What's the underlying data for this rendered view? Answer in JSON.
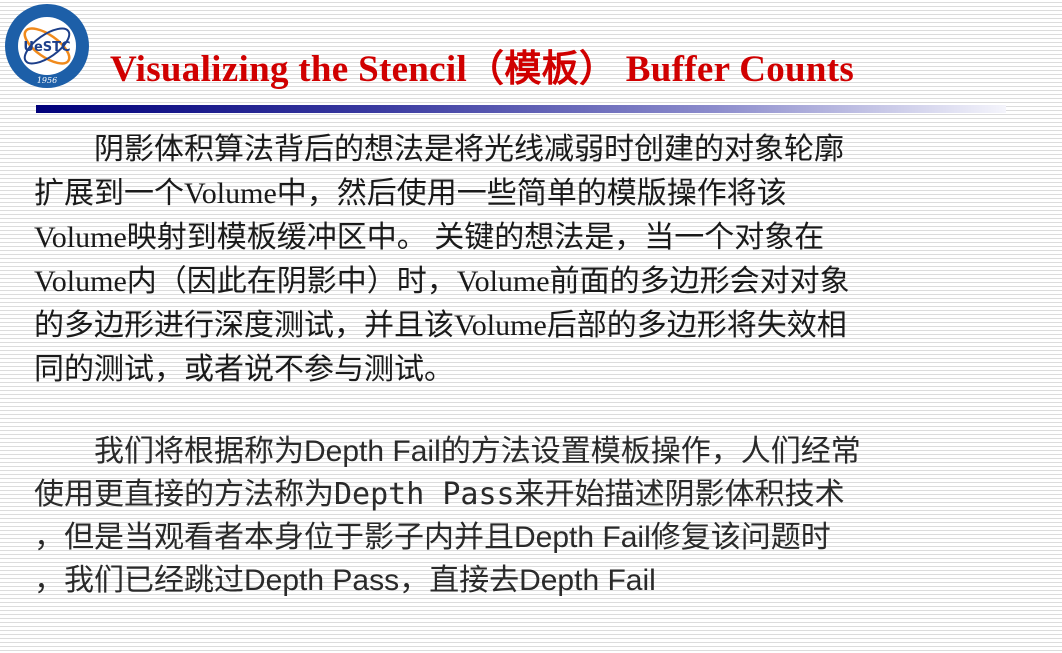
{
  "logo": {
    "text": "UESTC",
    "year": "1956"
  },
  "title": "Visualizing the Stencil（模板） Buffer Counts",
  "paragraph1": [
    "　　阴影体积算法背后的想法是将光线减弱时创建的对象轮廓",
    "扩展到一个Volume中，然后使用一些简单的模版操作将该",
    "Volume映射到模板缓冲区中。 关键的想法是，当一个对象在",
    "Volume内（因此在阴影中）时，Volume前面的多边形会对对象",
    "的多边形进行深度测试，并且该Volume后部的多边形将失效相",
    "同的测试，或者说不参与测试。"
  ],
  "paragraph2": {
    "line1": "　　我们将根据称为Depth Fail的方法设置模板操作，人们经常",
    "line2a": "使用更直接的方法称为",
    "line2b": "Depth Pass",
    "line2c": "来开始描述阴影体积技术",
    "line3": "，但是当观看者本身位于影子内并且Depth Fail修复该问题时",
    "line4": "，我们已经跳过Depth Pass，直接去Depth Fail"
  }
}
